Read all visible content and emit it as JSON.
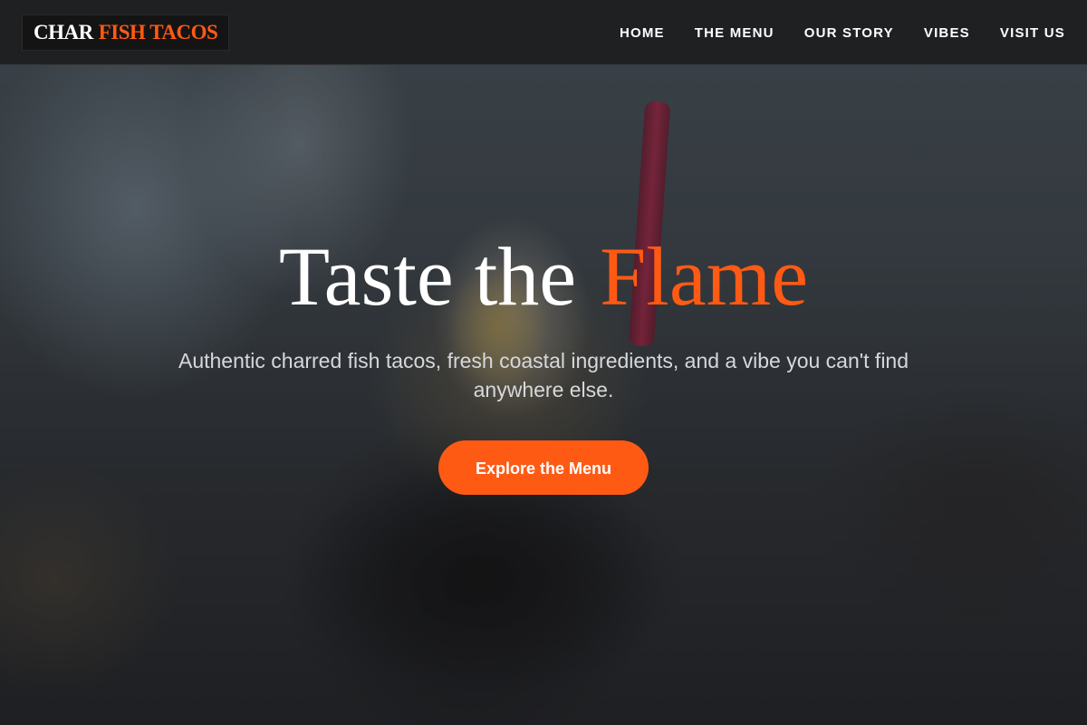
{
  "brand": {
    "name_white": "CHAR",
    "name_orange": "FISH TACOS"
  },
  "nav": {
    "items": [
      {
        "label": "HOME"
      },
      {
        "label": "THE MENU"
      },
      {
        "label": "OUR STORY"
      },
      {
        "label": "VIBES"
      },
      {
        "label": "VISIT US"
      }
    ]
  },
  "hero": {
    "title_main": "Taste the",
    "title_accent": "Flame",
    "subtitle": "Authentic charred fish tacos, fresh coastal ingredients, and a vibe you can't find anywhere else.",
    "cta_label": "Explore the Menu",
    "image_alt": "fish taco held in hand with drink in background"
  },
  "colors": {
    "accent": "#ff5a14",
    "navbar_bg": "#1e1f21",
    "text_primary": "#ffffff",
    "text_secondary": "#d6d8da"
  }
}
